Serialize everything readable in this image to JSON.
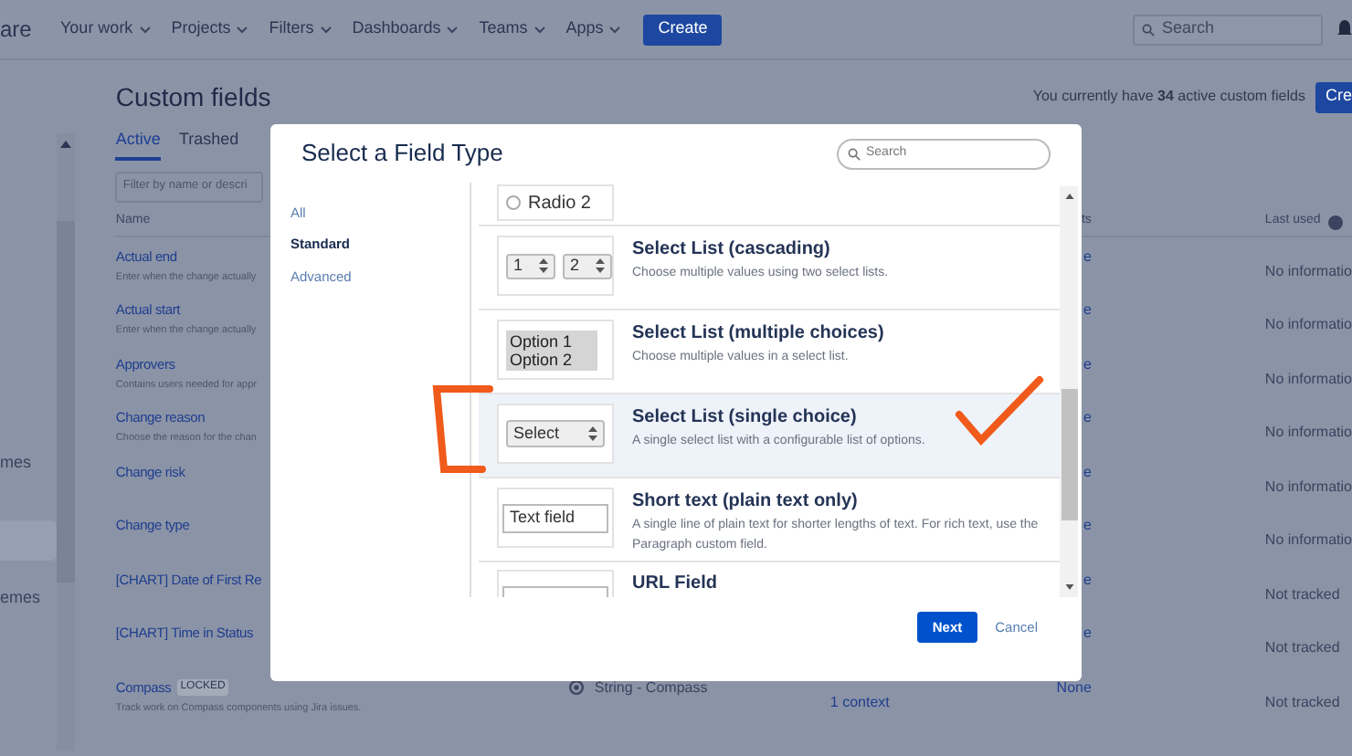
{
  "topbar": {
    "logo": "are",
    "nav": [
      "Your work",
      "Projects",
      "Filters",
      "Dashboards",
      "Teams",
      "Apps"
    ],
    "create": "Create",
    "search": {
      "placeholder": "Search"
    }
  },
  "sidebar": {
    "items": [
      {
        "label": "mes",
        "selected": false
      },
      {
        "selected": true
      },
      {
        "label": "emes",
        "selected": false
      }
    ]
  },
  "page": {
    "title": "Custom fields",
    "summary": "You currently have **34** active custom fields",
    "create": "Cre",
    "tabs": [
      {
        "label": "Active",
        "selected": true
      },
      {
        "label": "Trashed",
        "selected": false
      }
    ],
    "filter": {
      "placeholder": "Filter by name or descri"
    },
    "columns": [
      "Name",
      "ts",
      "Last used"
    ],
    "rows": [
      {
        "name": "Actual end",
        "description": "Enter when the change actually",
        "projects": "e",
        "last_used": "No informatio"
      },
      {
        "name": "Actual start",
        "description": "Enter when the change actually",
        "projects": "e",
        "last_used": "No informatio"
      },
      {
        "name": "Approvers",
        "description": "Contains users needed for appr",
        "projects": "e",
        "last_used": "No informatio"
      },
      {
        "name": "Change reason",
        "description": "Choose the reason for the chan",
        "projects": "e",
        "last_used": "No informatio"
      },
      {
        "name": "Change risk",
        "projects": "e",
        "last_used": "No informatio"
      },
      {
        "name": "Change type",
        "projects": "e",
        "last_used": "No informatio"
      },
      {
        "name": "[CHART] Date of First Re",
        "projects": "e",
        "last_used": "Not tracked"
      },
      {
        "name": "[CHART] Time in Status",
        "projects": "e",
        "last_used": "Not tracked"
      },
      {
        "name": "Compass",
        "badge": "LOCKED",
        "description": "Track work on Compass components using Jira issues.",
        "type": "String - Compass",
        "contexts": "1 context",
        "projects": "None",
        "last_used": "Not tracked"
      }
    ]
  },
  "dialog": {
    "title": "Select a Field Type",
    "search": {
      "placeholder": "Search"
    },
    "categories": [
      {
        "label": "All",
        "selected": false
      },
      {
        "label": "Standard",
        "selected": true
      },
      {
        "label": "Advanced",
        "selected": false
      }
    ],
    "types": [
      {
        "kind": "radio",
        "preview": [
          "Radio 2"
        ],
        "selected": false
      },
      {
        "kind": "cascade",
        "preview": [
          "1",
          "2"
        ],
        "title": "Select List (cascading)",
        "description": "Choose multiple values using two select lists.",
        "selected": false
      },
      {
        "kind": "multi",
        "preview": [
          "Option 1",
          "Option 2"
        ],
        "title": "Select List (multiple choices)",
        "description": "Choose multiple values in a select list.",
        "selected": false
      },
      {
        "kind": "single",
        "preview": [
          "Select"
        ],
        "title": "Select List (single choice)",
        "description": "A single select list with a configurable list of options.",
        "selected": true
      },
      {
        "kind": "text",
        "preview": [
          "Text field"
        ],
        "title": "Short text (plain text only)",
        "description": "A single line of plain text for shorter lengths of text. For rich text, use the Paragraph custom field.",
        "selected": false
      },
      {
        "kind": "url",
        "title": "URL Field",
        "selected": false
      }
    ],
    "next": "Next",
    "cancel": "Cancel"
  }
}
